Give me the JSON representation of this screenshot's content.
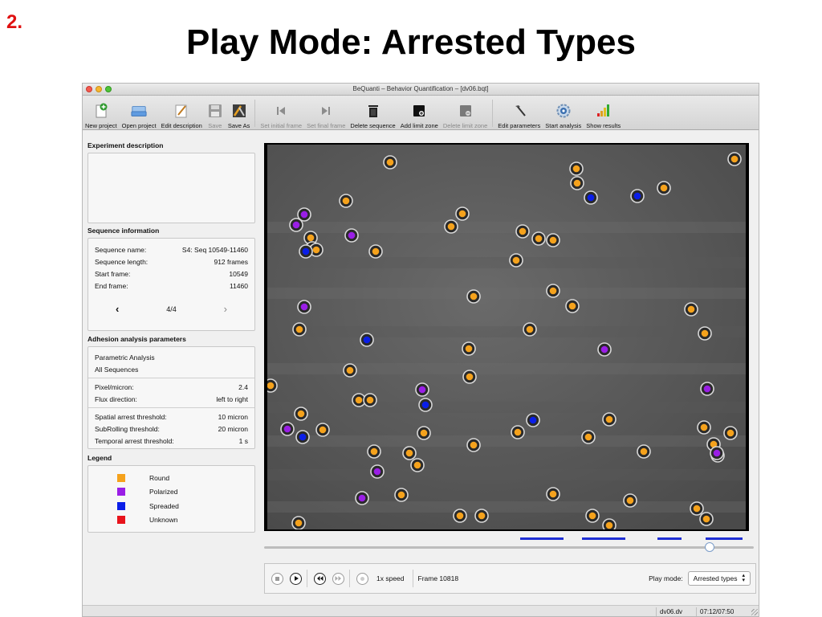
{
  "slide": {
    "number": "2.",
    "title": "Play Mode: Arrested Types"
  },
  "window": {
    "title": "BeQuanti – Behavior Quantification – [dv06.bqt]"
  },
  "toolbar": {
    "new_project": "New project",
    "open_project": "Open project",
    "edit_description": "Edit description",
    "save": "Save",
    "save_as": "Save As",
    "set_initial_frame": "Set initial frame",
    "set_final_frame": "Set final frame",
    "delete_sequence": "Delete sequence",
    "add_limit_zone": "Add limit zone",
    "delete_limit_zone": "Delete limit zone",
    "edit_parameters": "Edit parameters",
    "start_analysis": "Start analysis",
    "show_results": "Show results"
  },
  "experiment": {
    "heading": "Experiment description",
    "text": ""
  },
  "sequence": {
    "heading": "Sequence information",
    "name_label": "Sequence name:",
    "name_value": "S4: Seq 10549-11460",
    "length_label": "Sequence length:",
    "length_value": "912 frames",
    "start_label": "Start frame:",
    "start_value": "10549",
    "end_label": "End frame:",
    "end_value": "11460",
    "prev": "‹",
    "page": "4/4",
    "next": "›"
  },
  "adhesion": {
    "heading": "Adhesion analysis parameters",
    "analysis_type": "Parametric Analysis",
    "scope": "All Sequences",
    "pixel_label": "Pixel/micron:",
    "pixel_value": "2.4",
    "flux_label": "Flux direction:",
    "flux_value": "left to right",
    "spatial_label": "Spatial arrest threshold:",
    "spatial_value": "10 micron",
    "subrolling_label": "SubRolling threshold:",
    "subrolling_value": "20 micron",
    "temporal_label": "Temporal arrest threshold:",
    "temporal_value": "1 s"
  },
  "legend": {
    "heading": "Legend",
    "items": [
      {
        "label": "Round",
        "color": "#f5a21c"
      },
      {
        "label": "Polarized",
        "color": "#9a1ee6"
      },
      {
        "label": "Spreaded",
        "color": "#0a1ee8"
      },
      {
        "label": "Unknown",
        "color": "#e8141c"
      }
    ]
  },
  "playback": {
    "speed": "1x speed",
    "frame": "Frame 10818",
    "mode_label": "Play mode:",
    "mode_value": "Arrested types",
    "progress": 0.91
  },
  "status": {
    "file": "dv06.dv",
    "time": "07:12/07:50"
  },
  "cells": {
    "round": [
      [
        153,
        22
      ],
      [
        385,
        30
      ],
      [
        582,
        18
      ],
      [
        386,
        48
      ],
      [
        494,
        54
      ],
      [
        98,
        70
      ],
      [
        243,
        86
      ],
      [
        229,
        102
      ],
      [
        318,
        108
      ],
      [
        338,
        117
      ],
      [
        356,
        119
      ],
      [
        54,
        116
      ],
      [
        56,
        129
      ],
      [
        61,
        131
      ],
      [
        135,
        133
      ],
      [
        310,
        144
      ],
      [
        257,
        189
      ],
      [
        356,
        182
      ],
      [
        40,
        230
      ],
      [
        251,
        254
      ],
      [
        528,
        205
      ],
      [
        380,
        201
      ],
      [
        327,
        230
      ],
      [
        545,
        235
      ],
      [
        252,
        289
      ],
      [
        103,
        281
      ],
      [
        114,
        318
      ],
      [
        128,
        318
      ],
      [
        426,
        342
      ],
      [
        312,
        358
      ],
      [
        42,
        335
      ],
      [
        69,
        355
      ],
      [
        544,
        352
      ],
      [
        556,
        373
      ],
      [
        577,
        359
      ],
      [
        561,
        387
      ],
      [
        400,
        364
      ],
      [
        257,
        374
      ],
      [
        469,
        382
      ],
      [
        133,
        382
      ],
      [
        177,
        384
      ],
      [
        187,
        399
      ],
      [
        167,
        436
      ],
      [
        356,
        435
      ],
      [
        452,
        443
      ],
      [
        240,
        462
      ],
      [
        267,
        462
      ],
      [
        405,
        462
      ],
      [
        426,
        474
      ],
      [
        535,
        453
      ],
      [
        547,
        466
      ],
      [
        39,
        471
      ],
      [
        195,
        359
      ],
      [
        4,
        300
      ]
    ],
    "polarized": [
      [
        46,
        87
      ],
      [
        36,
        100
      ],
      [
        105,
        113
      ],
      [
        46,
        202
      ],
      [
        420,
        255
      ],
      [
        193,
        305
      ],
      [
        25,
        354
      ],
      [
        548,
        304
      ],
      [
        560,
        384
      ],
      [
        137,
        407
      ],
      [
        118,
        440
      ]
    ],
    "spreaded": [
      [
        403,
        66
      ],
      [
        461,
        64
      ],
      [
        48,
        133
      ],
      [
        124,
        243
      ],
      [
        197,
        324
      ],
      [
        331,
        343
      ],
      [
        44,
        364
      ]
    ]
  }
}
